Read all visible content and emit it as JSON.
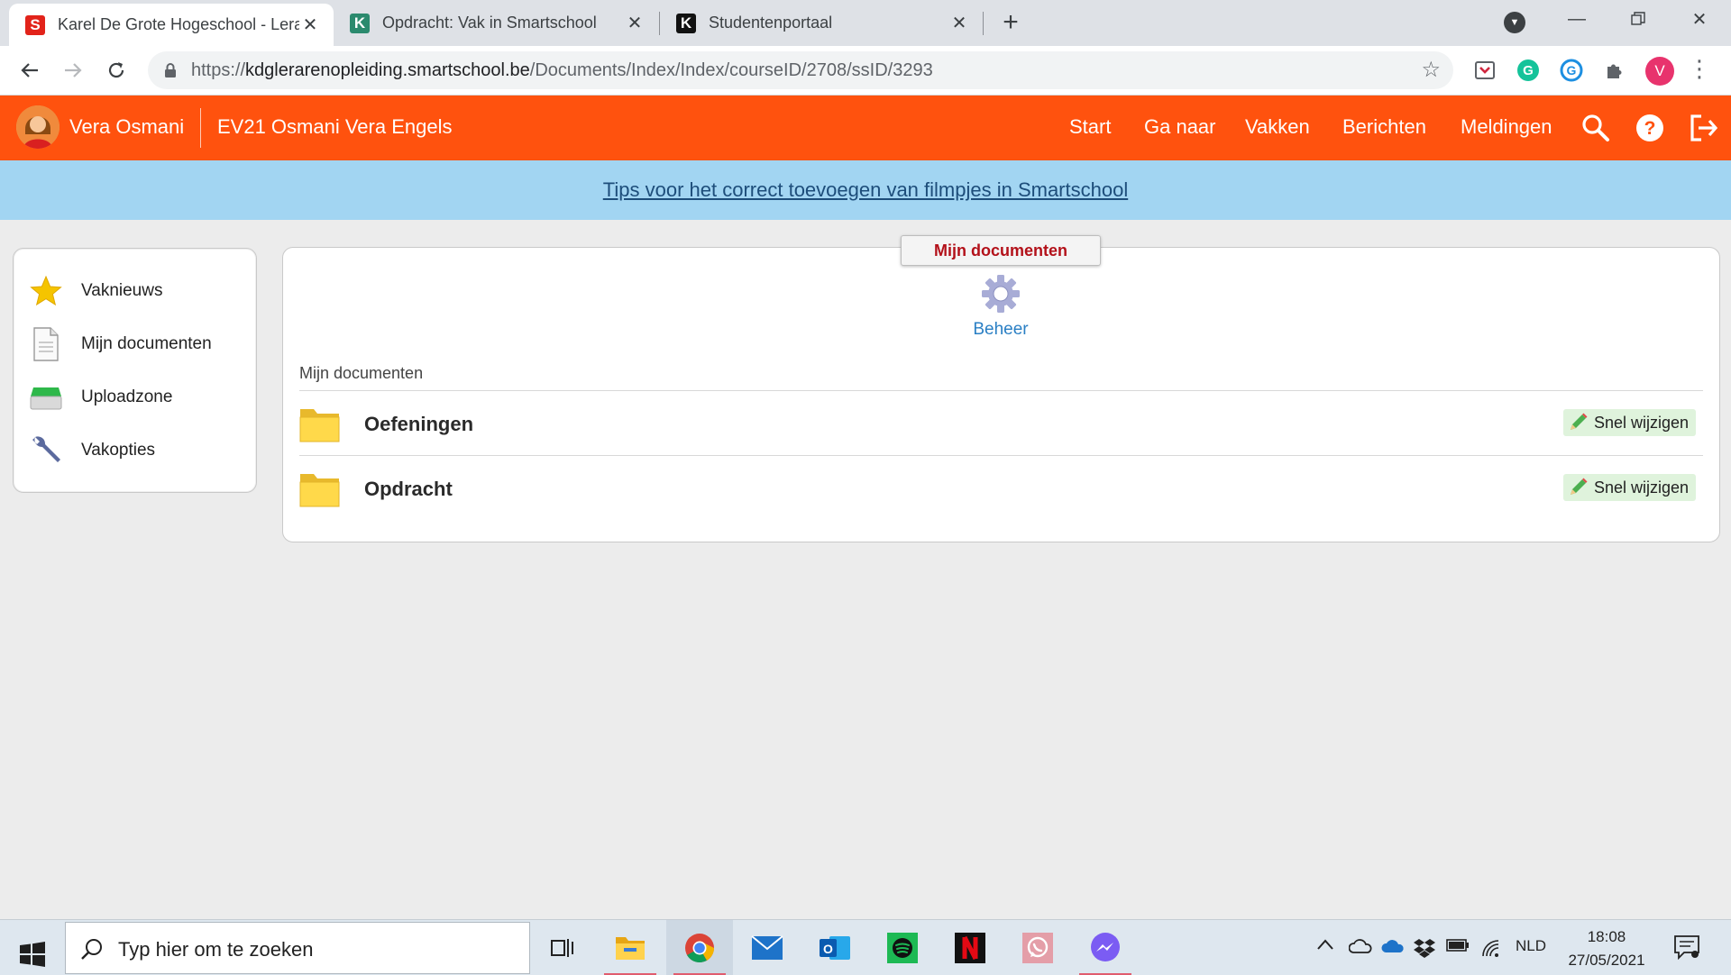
{
  "browser": {
    "tabs": [
      {
        "title": "Karel De Grote Hogeschool - Lerarenopleiding",
        "icon": "smartschool-s-icon",
        "active": true
      },
      {
        "title": "Opdracht: Vak in Smartschool",
        "icon": "k-green-icon",
        "active": false
      },
      {
        "title": "Studentenportaal",
        "icon": "k-black-icon",
        "active": false
      }
    ],
    "new_tab": "+",
    "url_prefix": "https://",
    "url_host": "kdglerarenopleiding.smartschool.be",
    "url_path": "/Documents/Index/Index/courseID/2708/ssID/3293",
    "profile_initial": "V"
  },
  "header": {
    "user_name": "Vera Osmani",
    "course_name": "EV21 Osmani Vera Engels",
    "nav": [
      "Start",
      "Ga naar",
      "Vakken",
      "Berichten",
      "Meldingen"
    ],
    "accent_color": "#ff520e"
  },
  "banner": {
    "link_text": "Tips voor het correct toevoegen van filmpjes in Smartschool"
  },
  "sidebar": {
    "items": [
      {
        "label": "Vaknieuws",
        "icon": "star-icon"
      },
      {
        "label": "Mijn documenten",
        "icon": "document-icon"
      },
      {
        "label": "Uploadzone",
        "icon": "inbox-tray-icon"
      },
      {
        "label": "Vakopties",
        "icon": "wrench-icon"
      }
    ]
  },
  "main": {
    "tab_title": "Mijn documenten",
    "beheer_label": "Beheer",
    "section_label": "Mijn documenten",
    "folders": [
      {
        "name": "Oefeningen",
        "action": "Snel wijzigen"
      },
      {
        "name": "Opdracht",
        "action": "Snel wijzigen"
      }
    ]
  },
  "taskbar": {
    "search_placeholder": "Typ hier om te zoeken",
    "language": "NLD",
    "time": "18:08",
    "date": "27/05/2021"
  }
}
